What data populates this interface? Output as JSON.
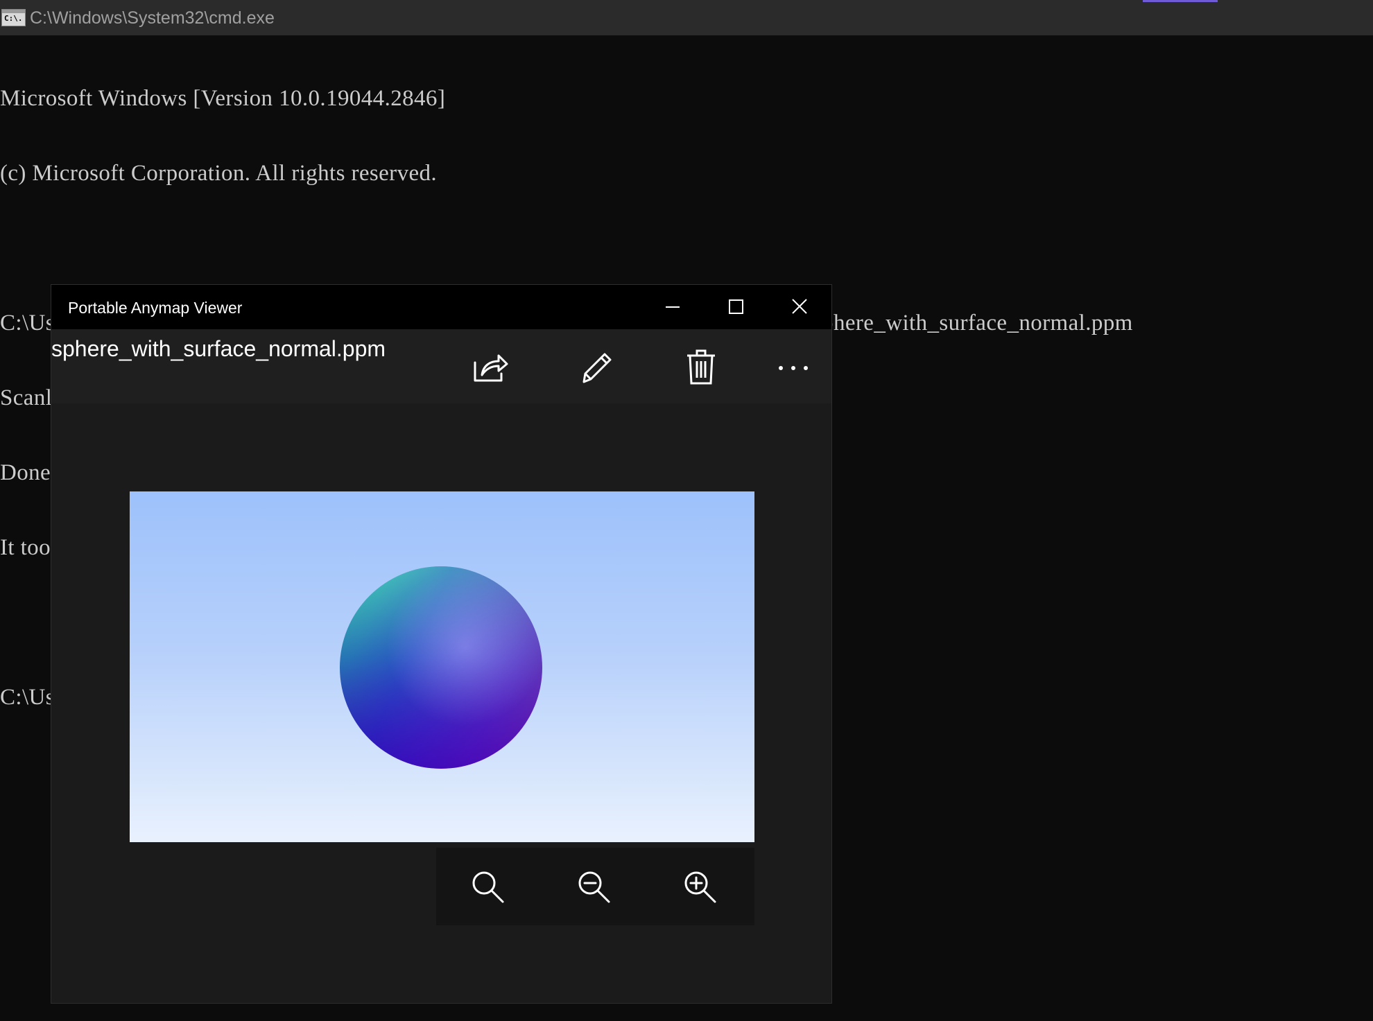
{
  "cmd": {
    "title": "C:\\Windows\\System32\\cmd.exe",
    "icon": "cmd-app-icon",
    "icon_text": "C:\\."
  },
  "console": {
    "lines": [
      "Microsoft Windows [Version 10.0.19044.2846]",
      "(c) Microsoft Corporation. All rights reserved.",
      "",
      "C:\\Users\\Xiaoyang\\Desktop\\8599\\8599RayTracer\\x64\\Release>8599RayTracer.exe > sphere_with_surface_normal.ppm",
      "Scanlines Remaining: 0",
      "Done.",
      "It took 76 microseconds.",
      "",
      "C:\\Users\\Xiaoyang\\Desktop\\8599\\8599RayTracer\\x64\\Release>"
    ]
  },
  "viewer": {
    "title": "Portable Anymap Viewer",
    "file_name": "sphere_with_surface_normal.ppm",
    "window_buttons": [
      "minimize-icon",
      "maximize-icon",
      "close-icon"
    ],
    "toolbar_icons": [
      "share-icon",
      "edit-pencil-icon",
      "delete-trash-icon",
      "more-options-icon"
    ],
    "zoom_icons": [
      "zoom-reset-icon",
      "zoom-out-icon",
      "zoom-in-icon"
    ]
  },
  "colors": {
    "console_bg": "#0c0c0c",
    "console_text": "#cccccc",
    "viewer_bg": "#1b1b1b",
    "accent": "#6f5bd6"
  }
}
